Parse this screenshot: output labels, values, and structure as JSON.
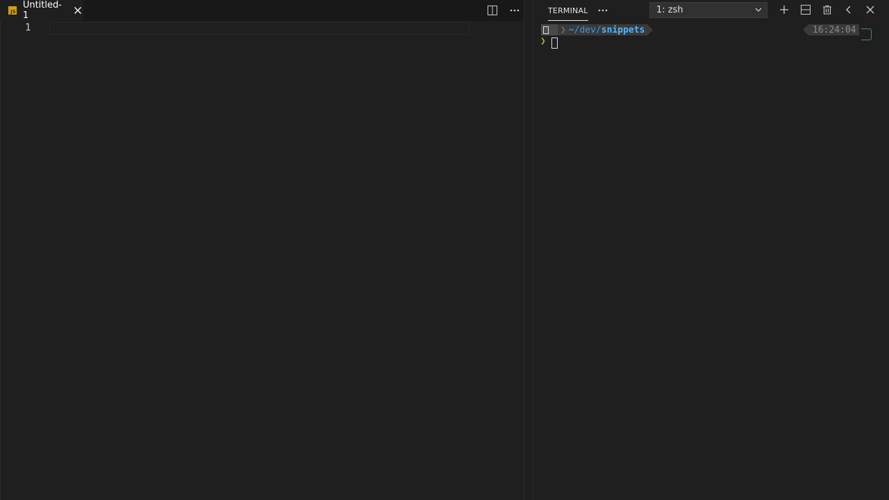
{
  "editor": {
    "tab": {
      "title": "Untitled-1",
      "icon_text": "JS",
      "icon": "js-file-icon",
      "close_icon": "close-icon"
    },
    "actions": {
      "split_icon": "split-editor-icon",
      "more_icon": "more-actions-icon"
    },
    "line_numbers": [
      "1"
    ]
  },
  "terminal": {
    "panel_tab": "TERMINAL",
    "more_icon": "more-actions-icon",
    "selected_terminal": "1: zsh",
    "actions": [
      "add-icon",
      "split-terminal-icon",
      "trash-icon",
      "chevron-left-icon",
      "close-icon"
    ],
    "prompt": {
      "tilde": "~",
      "dim_path": "/dev/",
      "bright_path": "snippets",
      "symbol": "❯",
      "time": "16:24:04"
    }
  },
  "colors": {
    "background": "#1f1f1f",
    "tab_bar": "#181818",
    "js_icon": "#d4a017",
    "path_blue": "#4fb3ff",
    "prompt_green": "#8ac926"
  }
}
